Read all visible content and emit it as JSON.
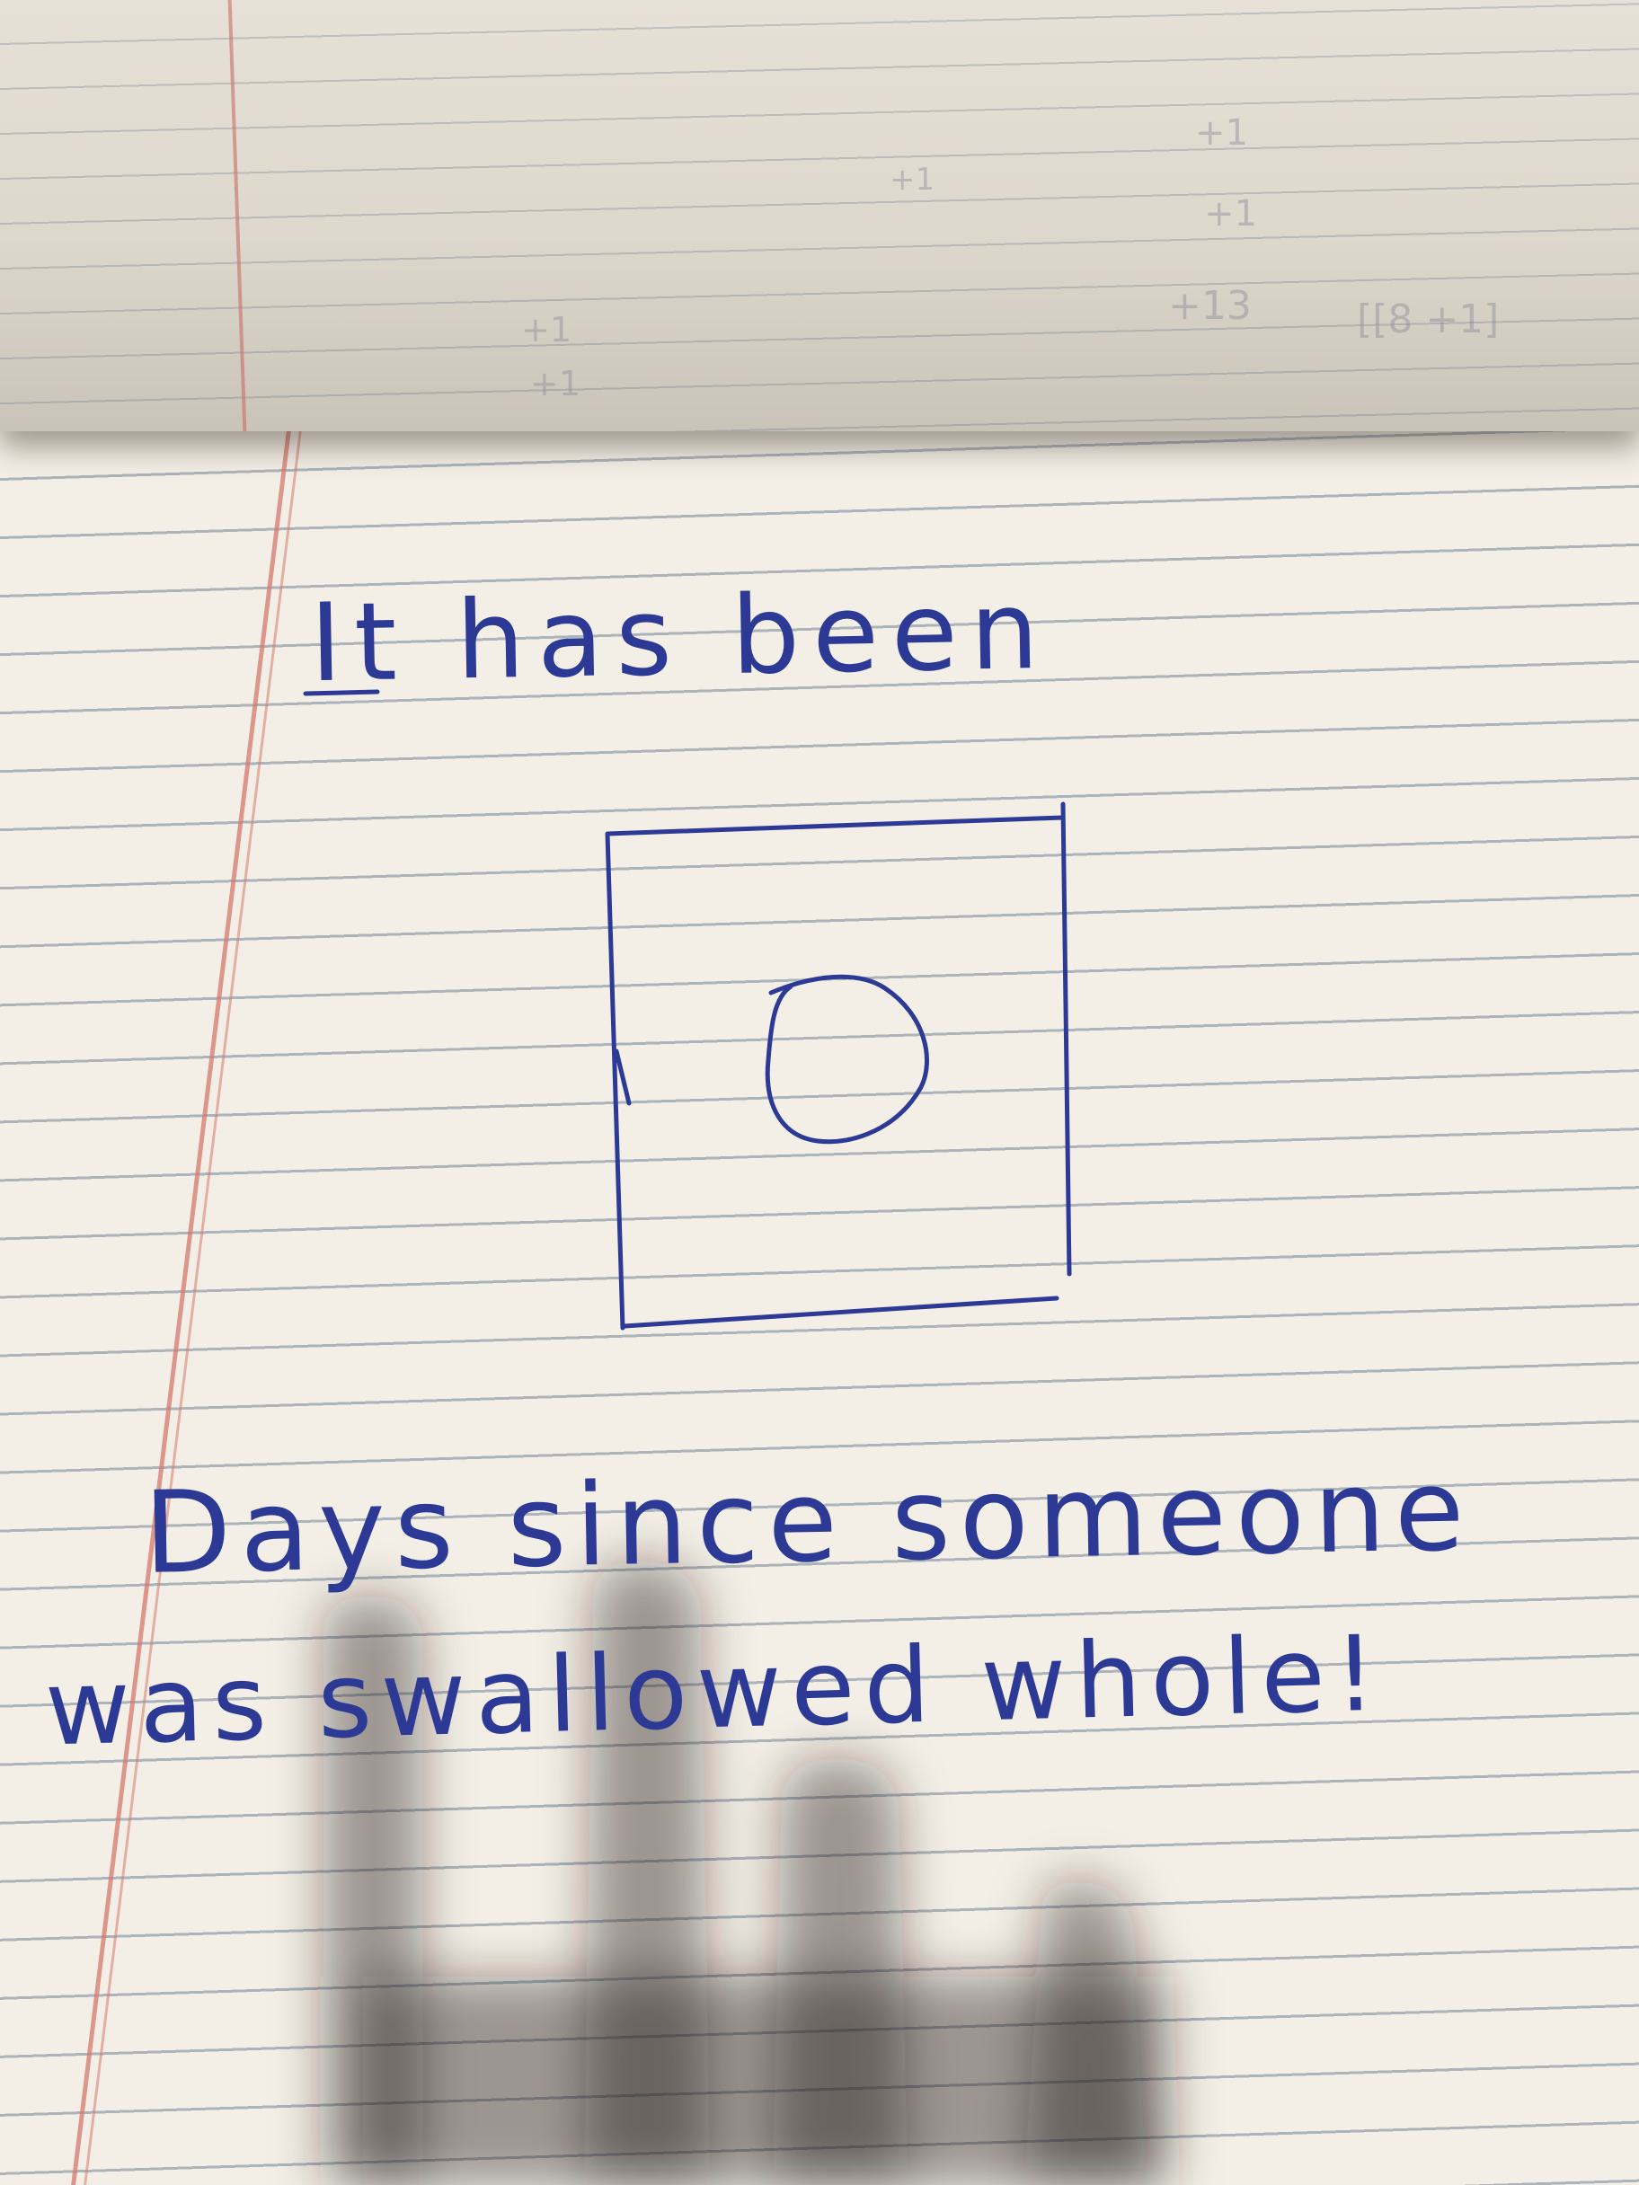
{
  "note": {
    "line_1": "It has been",
    "counter_value": "0",
    "line_2": "Days since someone",
    "line_3": "was swallowed whole!"
  },
  "background_sheet_marks": [
    "+1",
    "+1",
    "+13",
    "[[8 +1]",
    "+1",
    "+1",
    "+1"
  ],
  "colors": {
    "ink": "#2c3a96",
    "paper": "#f3efe6",
    "rule_line": "#6478917f",
    "margin_line": "#d6786e"
  }
}
